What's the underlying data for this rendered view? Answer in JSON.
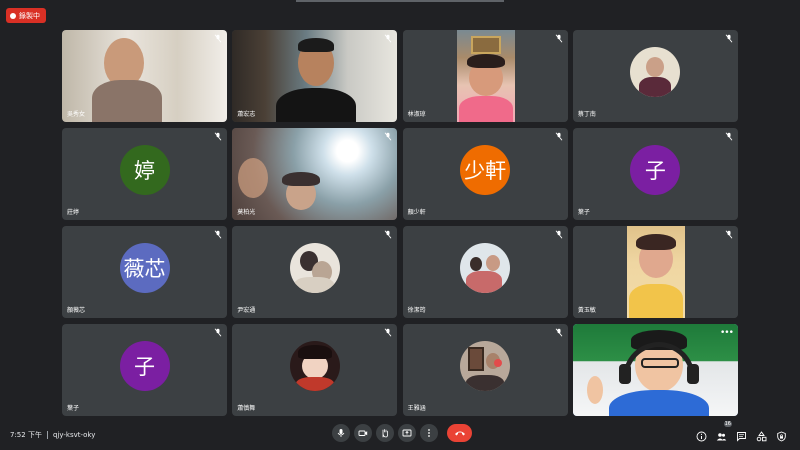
{
  "recording": {
    "label": "錄製中"
  },
  "participants": [
    {
      "name": "吳秀女",
      "avatar": "",
      "color": ""
    },
    {
      "name": "蕭宏志",
      "avatar": "",
      "color": ""
    },
    {
      "name": "林淑琼",
      "avatar": "",
      "color": ""
    },
    {
      "name": "蔡丁南",
      "avatar": "",
      "color": ""
    },
    {
      "name": "莊婷",
      "avatar": "婷",
      "color": "#33691e"
    },
    {
      "name": "莫柏光",
      "avatar": "",
      "color": ""
    },
    {
      "name": "顏少軒",
      "avatar": "少軒",
      "color": "#ef6c00"
    },
    {
      "name": "葉子",
      "avatar": "子",
      "color": "#7b1fa2"
    },
    {
      "name": "顏薇芯",
      "avatar": "薇芯",
      "color": "#5c6bc0"
    },
    {
      "name": "尹宏通",
      "avatar": "",
      "color": ""
    },
    {
      "name": "徐潔筠",
      "avatar": "",
      "color": ""
    },
    {
      "name": "黃玉敏",
      "avatar": "",
      "color": ""
    },
    {
      "name": "葉子",
      "avatar": "子",
      "color": "#7b1fa2"
    },
    {
      "name": "蕭慎舞",
      "avatar": "",
      "color": ""
    },
    {
      "name": "王雅涵",
      "avatar": "",
      "color": ""
    },
    {
      "name": "",
      "avatar": "",
      "color": ""
    }
  ],
  "meeting": {
    "time": "7:52 下午",
    "code": "qjy-ksvt-oky"
  },
  "controls": {
    "mic": "mic-icon",
    "camera": "camera-icon",
    "raise_hand": "raise-hand-icon",
    "present": "present-icon",
    "more": "more-vert-icon",
    "hang_up": "hang-up-icon"
  },
  "side_panel": {
    "people_count": "16"
  },
  "colors": {
    "background": "#202124",
    "tile": "#3c4043",
    "hangup": "#ea4335",
    "recording": "#d93025"
  }
}
